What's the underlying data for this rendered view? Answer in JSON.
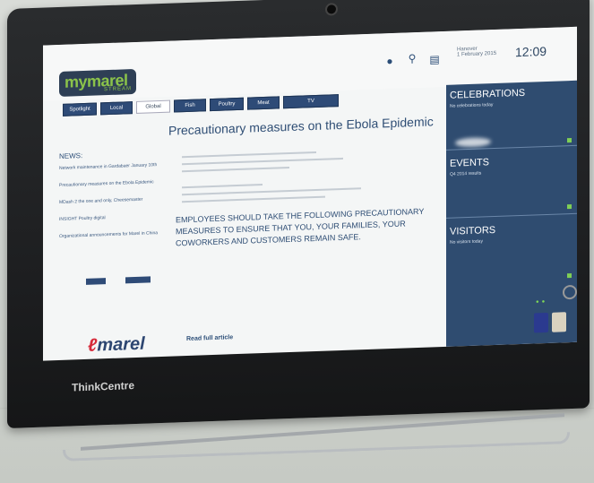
{
  "header": {
    "logo_text": "mymarel",
    "logo_subtext": "STREAM",
    "user_name": "Hanover",
    "user_date": "1 February 2015",
    "clock": "12:09"
  },
  "tabs": [
    {
      "label": "Spotlight"
    },
    {
      "label": "Local"
    },
    {
      "label": "Global"
    },
    {
      "label": "Fish"
    },
    {
      "label": "Poultry"
    },
    {
      "label": "Meat"
    },
    {
      "label": "TV"
    }
  ],
  "news": {
    "title": "NEWS:",
    "items": [
      "Network maintenance in Gardabaer January 10th",
      "Precautionary measures on the Ebola Epidemic",
      "MDash 2 the one and only, Cheesemaster",
      "INSIGHT Poultry digital",
      "Organizational announcements for Marel in China"
    ]
  },
  "article": {
    "title": "Precautionary measures on the Ebola Epidemic",
    "body": "EMPLOYEES SHOULD TAKE THE FOLLOWING PRECAUTIONARY MEASURES TO ENSURE THAT YOU, YOUR FAMILIES, YOUR COWORKERS AND CUSTOMERS REMAIN SAFE.",
    "read_more": "Read full article"
  },
  "footer": {
    "logo_text": "marel"
  },
  "right_panel": {
    "celebrations": {
      "title": "CELEBRATIONS",
      "sub": "No celebrations today"
    },
    "events": {
      "title": "EVENTS",
      "sub": "Q4 2014 results"
    },
    "visitors": {
      "title": "VISITORS",
      "sub": "No visitors today"
    }
  },
  "bezel": {
    "brand": "ThinkCentre"
  },
  "colors": {
    "panel_blue": "#2f4c70",
    "accent_green": "#8bc34a",
    "marel_red": "#d62a3a"
  }
}
